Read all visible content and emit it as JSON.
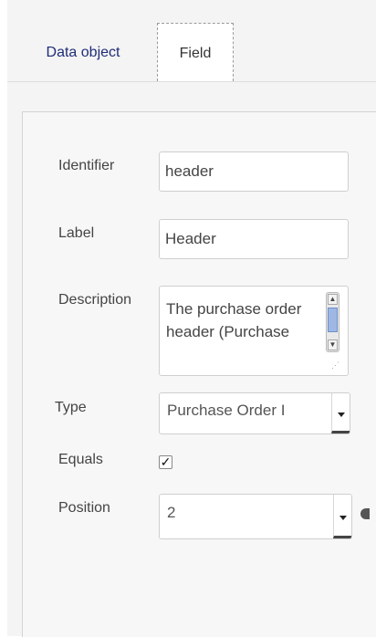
{
  "tabs": {
    "data_object": "Data object",
    "field": "Field"
  },
  "form": {
    "identifier": {
      "label": "Identifier",
      "value": "header"
    },
    "label": {
      "label": "Label",
      "value": "Header"
    },
    "description": {
      "label": "Description",
      "value": "The purchase order header (Purchase"
    },
    "type": {
      "label": "Type",
      "value": "Purchase Order I"
    },
    "equals": {
      "label": "Equals",
      "checked": true,
      "check_glyph": "✓"
    },
    "position": {
      "label": "Position",
      "value": "2"
    }
  },
  "icons": {
    "scroll_up": "▲",
    "scroll_down": "▼",
    "resize": "⋰"
  }
}
